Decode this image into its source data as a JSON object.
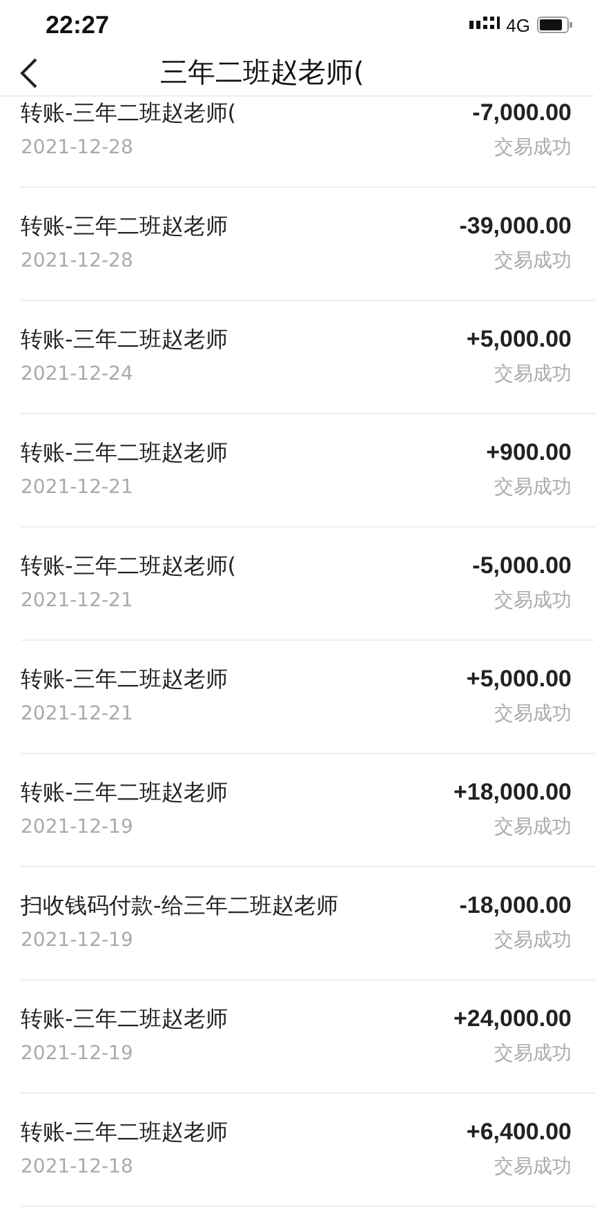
{
  "status_bar": {
    "time": "22:27",
    "network": "4G"
  },
  "header": {
    "title": "三年二班赵老师("
  },
  "transactions": [
    {
      "name": "转账-三年二班赵老师(",
      "date": "2021-12-28",
      "amount": "-7,000.00",
      "status": "交易成功"
    },
    {
      "name": "转账-三年二班赵老师",
      "date": "2021-12-28",
      "amount": "-39,000.00",
      "status": "交易成功"
    },
    {
      "name": "转账-三年二班赵老师",
      "date": "2021-12-24",
      "amount": "+5,000.00",
      "status": "交易成功"
    },
    {
      "name": "转账-三年二班赵老师",
      "date": "2021-12-21",
      "amount": "+900.00",
      "status": "交易成功"
    },
    {
      "name": "转账-三年二班赵老师(",
      "date": "2021-12-21",
      "amount": "-5,000.00",
      "status": "交易成功"
    },
    {
      "name": "转账-三年二班赵老师",
      "date": "2021-12-21",
      "amount": "+5,000.00",
      "status": "交易成功"
    },
    {
      "name": "转账-三年二班赵老师",
      "date": "2021-12-19",
      "amount": "+18,000.00",
      "status": "交易成功"
    },
    {
      "name": "扫收钱码付款-给三年二班赵老师",
      "date": "2021-12-19",
      "amount": "-18,000.00",
      "status": "交易成功"
    },
    {
      "name": "转账-三年二班赵老师",
      "date": "2021-12-19",
      "amount": "+24,000.00",
      "status": "交易成功"
    },
    {
      "name": "转账-三年二班赵老师",
      "date": "2021-12-18",
      "amount": "+6,400.00",
      "status": "交易成功"
    }
  ]
}
